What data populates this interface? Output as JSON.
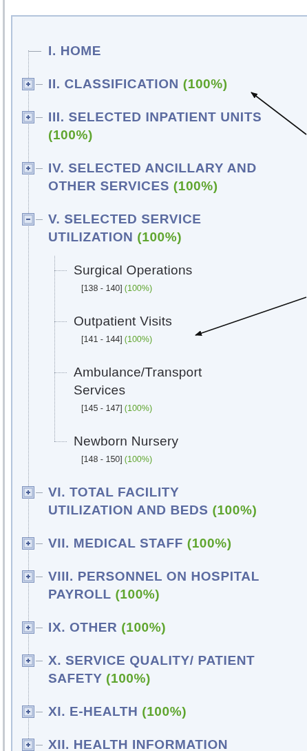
{
  "sections": [
    {
      "label": "I. HOME"
    },
    {
      "label": "II. CLASSIFICATION",
      "percent": "(100%)",
      "expanded": false
    },
    {
      "label": "III. SELECTED INPATIENT UNITS",
      "percent": "(100%)",
      "expanded": false
    },
    {
      "label": "IV. SELECTED ANCILLARY AND OTHER SERVICES",
      "percent": "(100%)",
      "expanded": false
    },
    {
      "label": "V. SELECTED SERVICE UTILIZATION",
      "percent": "(100%)",
      "expanded": true,
      "children": [
        {
          "label": "Surgical Operations",
          "range": "[138 - 140]",
          "percent": "(100%)"
        },
        {
          "label": "Outpatient Visits",
          "range": "[141 - 144]",
          "percent": "(100%)"
        },
        {
          "label": "Ambulance/Transport Services",
          "range": "[145 - 147]",
          "percent": "(100%)"
        },
        {
          "label": "Newborn Nursery",
          "range": "[148 - 150]",
          "percent": "(100%)"
        }
      ]
    },
    {
      "label": "VI. TOTAL FACILITY UTILIZATION AND BEDS",
      "percent": "(100%)",
      "expanded": false
    },
    {
      "label": "VII. MEDICAL STAFF",
      "percent": "(100%)",
      "expanded": false
    },
    {
      "label": "VIII. PERSONNEL ON HOSPITAL PAYROLL",
      "percent": "(100%)",
      "expanded": false
    },
    {
      "label": "IX. OTHER",
      "percent": "(100%)",
      "expanded": false
    },
    {
      "label": "X. SERVICE QUALITY/ PATIENT SAFETY",
      "percent": "(100%)",
      "expanded": false
    },
    {
      "label": "XI. E-HEALTH",
      "percent": "(100%)",
      "expanded": false
    },
    {
      "label": "XII. HEALTH INFORMATION",
      "expanded": false
    }
  ]
}
